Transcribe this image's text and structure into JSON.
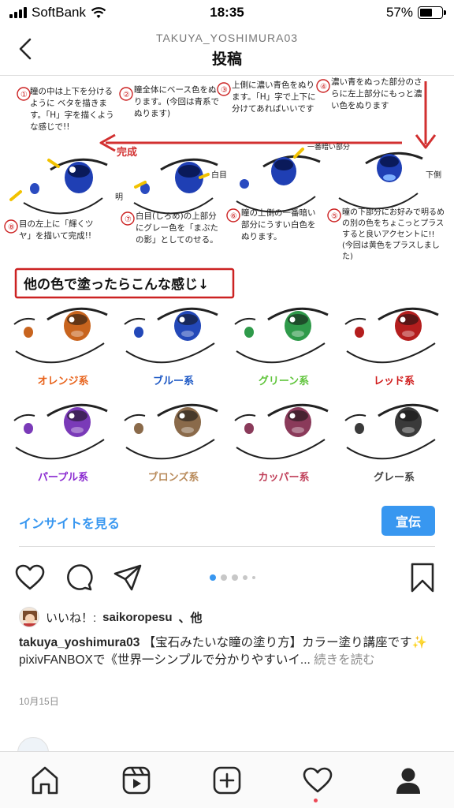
{
  "status_bar": {
    "carrier": "SoftBank",
    "time": "18:35",
    "battery_percent_label": "57%",
    "battery_level": 0.57,
    "icons": [
      "signal-icon",
      "wifi-icon",
      "battery-icon"
    ]
  },
  "header": {
    "username": "TAKUYA_YOSHIMURA03",
    "title": "投稿",
    "back_icon": "chevron-left-icon"
  },
  "post_image": {
    "steps": [
      {
        "num": "①",
        "text": "瞳の中は上下を分けるように ベタを描きます。「H」字を描くような感じで!!"
      },
      {
        "num": "②",
        "text": "瞳全体にベース色をぬります。(今回は青系でぬります)"
      },
      {
        "num": "③",
        "text": "上側に濃い青色をぬります。「H」字で上下に分けてあればいいです"
      },
      {
        "num": "④",
        "text": "濃い青をぬった部分のさらに左上部分にもっと濃い色をぬります"
      },
      {
        "num": "⑤",
        "text": "瞳の下部分にお好みで明るめの別の色をちょこっとプラスすると良いアクセントに!! (今回は黄色をプラスしました)"
      },
      {
        "num": "⑥",
        "text": "瞳の上側の一番暗い部分にうすい白色をぬります。"
      },
      {
        "num": "⑦",
        "text": "白目(しろめ)の上部分にグレー色を「まぶたの影」としてのせる。"
      },
      {
        "num": "⑧",
        "text": "目の左上に「輝くツヤ」を描いて完成!!"
      }
    ],
    "annotations": {
      "done_arrow": "完成",
      "white_eye": "白目",
      "dark_part": "一番暗い部分",
      "lower_side": "下側",
      "brightness": "明"
    },
    "variants_heading": "他の色で塗ったらこんな感じ↓",
    "variants": [
      {
        "label": "オレンジ系",
        "color": "#e8631c",
        "iris": "#c8641e"
      },
      {
        "label": "ブルー系",
        "color": "#1a56c4",
        "iris": "#2348b8"
      },
      {
        "label": "グリーン系",
        "color": "#5fc43a",
        "iris": "#2f9a4a"
      },
      {
        "label": "レッド系",
        "color": "#d01c1c",
        "iris": "#b41e1e"
      },
      {
        "label": "パープル系",
        "color": "#8a2ad0",
        "iris": "#7a3ab8"
      },
      {
        "label": "ブロンズ系",
        "color": "#b88a5a",
        "iris": "#8a6a4a"
      },
      {
        "label": "カッパー系",
        "color": "#c0405a",
        "iris": "#8a3a5a"
      },
      {
        "label": "グレー系",
        "color": "#444444",
        "iris": "#3a3a3a"
      }
    ]
  },
  "insight": {
    "link_label": "インサイトを見る",
    "promote_label": "宣伝"
  },
  "actions": {
    "icons": [
      "heart-icon",
      "comment-icon",
      "share-icon",
      "bookmark-icon"
    ],
    "carousel_total": 5,
    "carousel_active": 1
  },
  "likes": {
    "prefix": "いいね！:",
    "user": "saikoropesu",
    "suffix": "、他"
  },
  "caption": {
    "username": "takuya_yoshimura03",
    "text": "【宝石みたいな瞳の塗り方】カラー塗り講座です✨",
    "line2": "pixivFANBOXで《世界一シンプルで分かりやすいイ...",
    "more": "続きを読む"
  },
  "date": "10月15日",
  "tabbar": {
    "icons": [
      "home-icon",
      "reels-icon",
      "new-post-icon",
      "activity-heart-icon",
      "profile-icon"
    ]
  }
}
